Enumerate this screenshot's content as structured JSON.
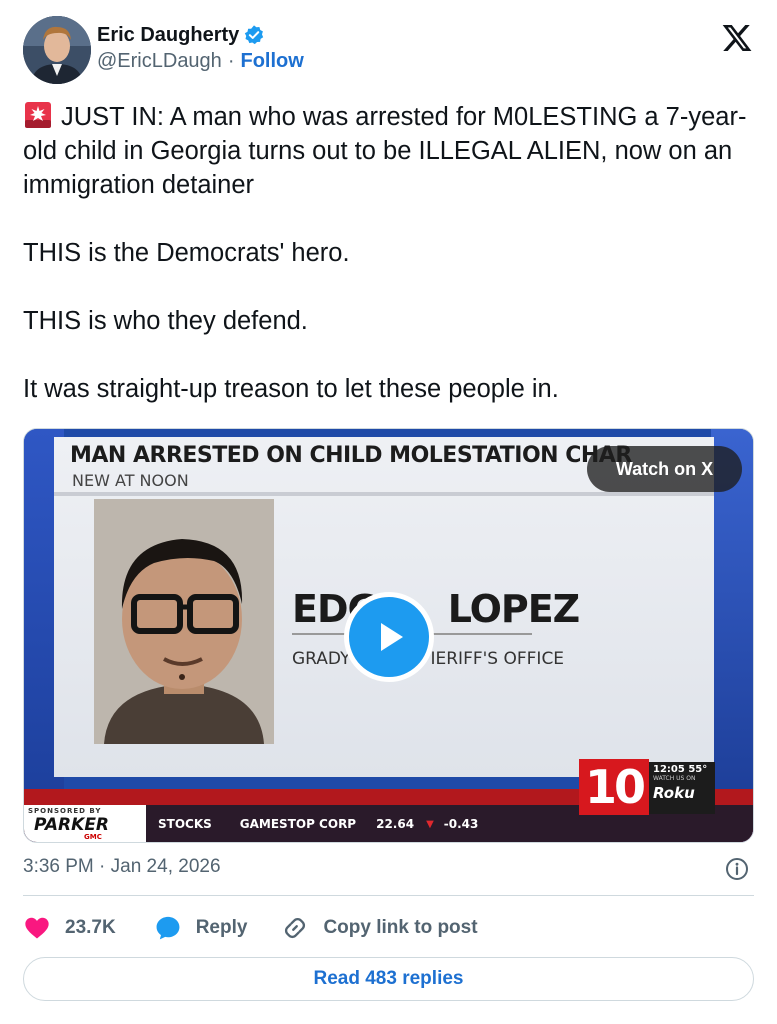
{
  "author": {
    "name": "Eric Daugherty",
    "handle": "@EricLDaugh",
    "separator": "·",
    "follow_label": "Follow",
    "verified": true
  },
  "brand": {
    "icon": "x-logo-icon"
  },
  "tweet": {
    "emoji": "rotating-light-icon",
    "text": "JUST IN: A man who was arrested for M0LESTING a 7-year-old child in Georgia turns out to be ILLEGAL ALIEN, now on an immigration detainer\n\nTHIS is the Democrats' hero.\n\nTHIS is who they defend.\n\nIt was straight-up treason to let these people in."
  },
  "media": {
    "headline": "MAN ARRESTED ON CHILD MOLESTATION CHAR",
    "subhead": "NEW AT NOON",
    "person_name": "EDGAR LOPEZ",
    "person_name_visible_left": "EDG",
    "person_name_visible_right": "LOPEZ",
    "agency_left": "GRADY",
    "agency_right": "IERIFF'S OFFICE",
    "watch_label": "Watch on X",
    "play_icon": "play-icon",
    "channel": "10",
    "clock": "12:05  55°",
    "watch_us_on": "WATCH US ON",
    "roku": "Roku",
    "ticker": {
      "sponsor_small": "SPONSORED BY",
      "sponsor_name": "PARKER",
      "sponsor_sub": "GMC",
      "label": "STOCKS",
      "company": "GAMESTOP CORP",
      "price": "22.64",
      "arrow": "▼",
      "change": "-0.43"
    }
  },
  "timestamp": "3:36 PM · Jan 24, 2026",
  "actions": {
    "likes": "23.7K",
    "reply_label": "Reply",
    "copy_label": "Copy link to post"
  },
  "read_replies_label": "Read 483 replies",
  "colors": {
    "accent": "#1d9bf0",
    "link": "#1d70d1",
    "like": "#f91880",
    "muted": "#536471"
  }
}
